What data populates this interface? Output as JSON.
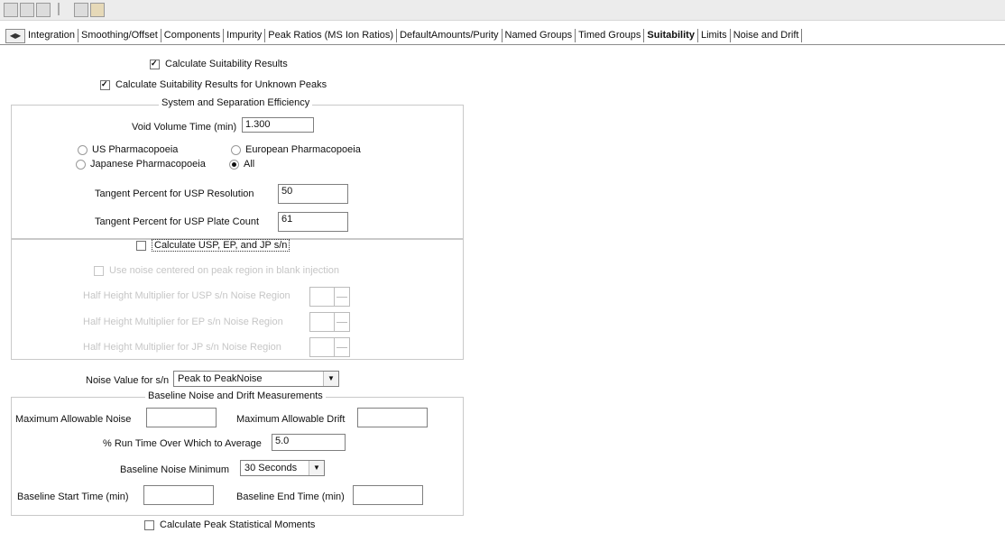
{
  "tabs": {
    "items": [
      {
        "label": "Integration"
      },
      {
        "label": "Smoothing/Offset"
      },
      {
        "label": "Components"
      },
      {
        "label": "Impurity"
      },
      {
        "label": "Peak Ratios (MS Ion Ratios)"
      },
      {
        "label": "DefaultAmounts/Purity"
      },
      {
        "label": "Named Groups"
      },
      {
        "label": "Timed Groups"
      },
      {
        "label": "Suitability"
      },
      {
        "label": "Limits"
      },
      {
        "label": "Noise and Drift"
      }
    ],
    "active_index": 8
  },
  "form": {
    "calc_suitability": {
      "label": "Calculate Suitability Results",
      "checked": true
    },
    "calc_unknown": {
      "label": "Calculate Suitability Results for Unknown Peaks",
      "checked": true
    },
    "sys_group": {
      "title": "System and Separation Efficiency",
      "void_label": "Void Volume Time (min)",
      "void_value": "1.300",
      "radio_usp": "US Pharmacopoeia",
      "radio_ep": "European Pharmacopoeia",
      "radio_jp": "Japanese Pharmacopoeia",
      "radio_all": "All",
      "selected": "All",
      "tangent_res_label": "Tangent Percent for USP Resolution",
      "tangent_res_value": "50",
      "tangent_plate_label": "Tangent Percent for USP Plate Count",
      "tangent_plate_value": "61"
    },
    "sn_group": {
      "calc_sn_label": "Calculate USP, EP, and JP s/n",
      "calc_sn_checked": false,
      "use_noise_label": "Use noise centered on peak region in blank injection",
      "half_usp_label": "Half Height Multiplier for USP s/n Noise Region",
      "half_ep_label": "Half Height Multiplier for EP s/n Noise Region",
      "half_jp_label": "Half Height Multiplier for JP s/n Noise Region"
    },
    "noise_value_label": "Noise Value for s/n",
    "noise_value_selected": "Peak to PeakNoise",
    "baseline_group": {
      "title": "Baseline Noise and Drift Measurements",
      "max_noise_label": "Maximum Allowable Noise",
      "max_noise_value": "",
      "max_drift_label": "Maximum Allowable Drift",
      "max_drift_value": "",
      "run_time_label": "% Run Time Over Which to Average",
      "run_time_value": "5.0",
      "noise_min_label": "Baseline Noise Minimum",
      "noise_min_selected": "30 Seconds",
      "start_label": "Baseline Start Time (min)",
      "start_value": "",
      "end_label": "Baseline End Time (min)",
      "end_value": ""
    },
    "calc_moments": {
      "label": "Calculate Peak Statistical Moments",
      "checked": false
    }
  }
}
